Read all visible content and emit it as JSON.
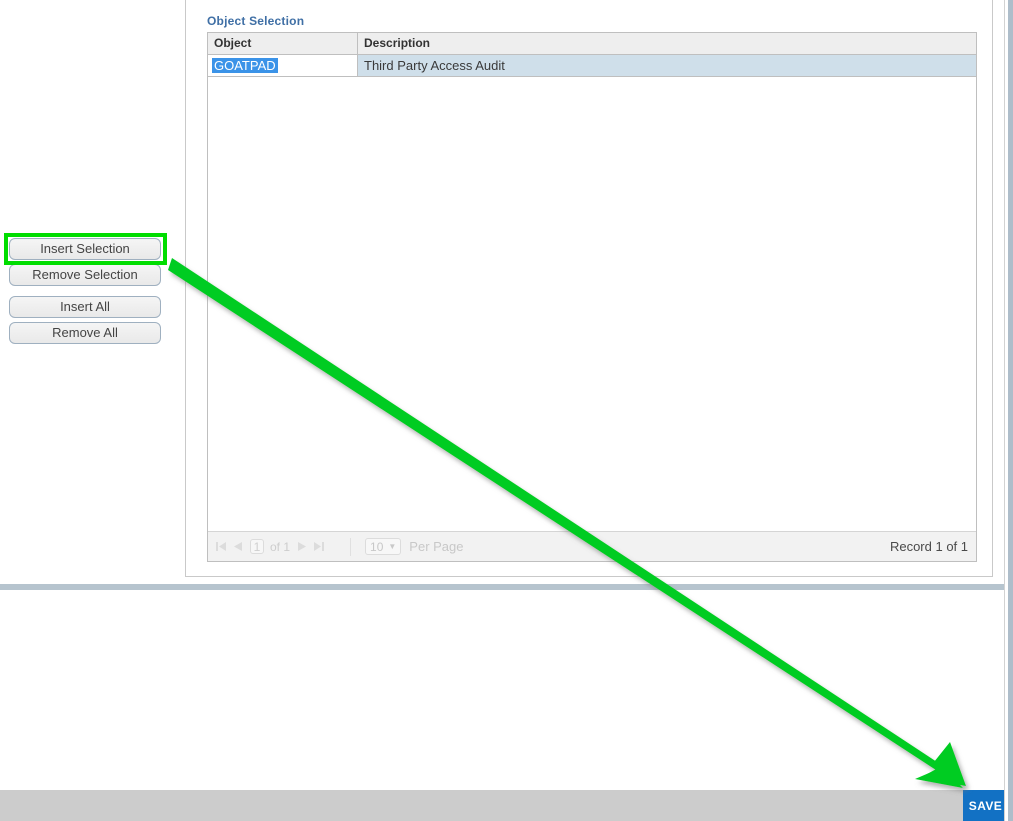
{
  "panel": {
    "title": "Object Selection"
  },
  "actions": {
    "buttons": [
      {
        "label": "Insert Selection",
        "name": "insert-selection-button",
        "highlighted": true
      },
      {
        "label": "Remove Selection",
        "name": "remove-selection-button",
        "highlighted": false
      },
      {
        "label": "Insert All",
        "name": "insert-all-button",
        "highlighted": false
      },
      {
        "label": "Remove All",
        "name": "remove-all-button",
        "highlighted": false
      }
    ]
  },
  "grid": {
    "columns": [
      {
        "key": "object",
        "label": "Object"
      },
      {
        "key": "description",
        "label": "Description"
      }
    ],
    "rows": [
      {
        "object": "GOATPAD",
        "description": "Third Party Access Audit",
        "selected": true
      }
    ]
  },
  "pager": {
    "first_icon": "⏮",
    "prev_icon": "◀",
    "page_value": "1",
    "of_text": "of 1",
    "next_icon": "▶",
    "last_icon": "⏭",
    "page_size": "10",
    "page_size_caret": "▼",
    "per_page_label": "Per Page",
    "record_label": "Record 1 of 1"
  },
  "footer": {
    "save_label": "SAVE"
  },
  "annotation": {
    "highlight_color": "#00dd00",
    "arrow_color": "#00cc22",
    "arrow_description": "arrow from Insert Selection button to SAVE button"
  },
  "colors": {
    "panel_title": "#3f6fa5",
    "selected_row": "#cfdfea",
    "text_selection": "#3b93e8",
    "save_button": "#1271c4",
    "footer_bar": "#cccccc",
    "divider": "#b6c4ce"
  }
}
